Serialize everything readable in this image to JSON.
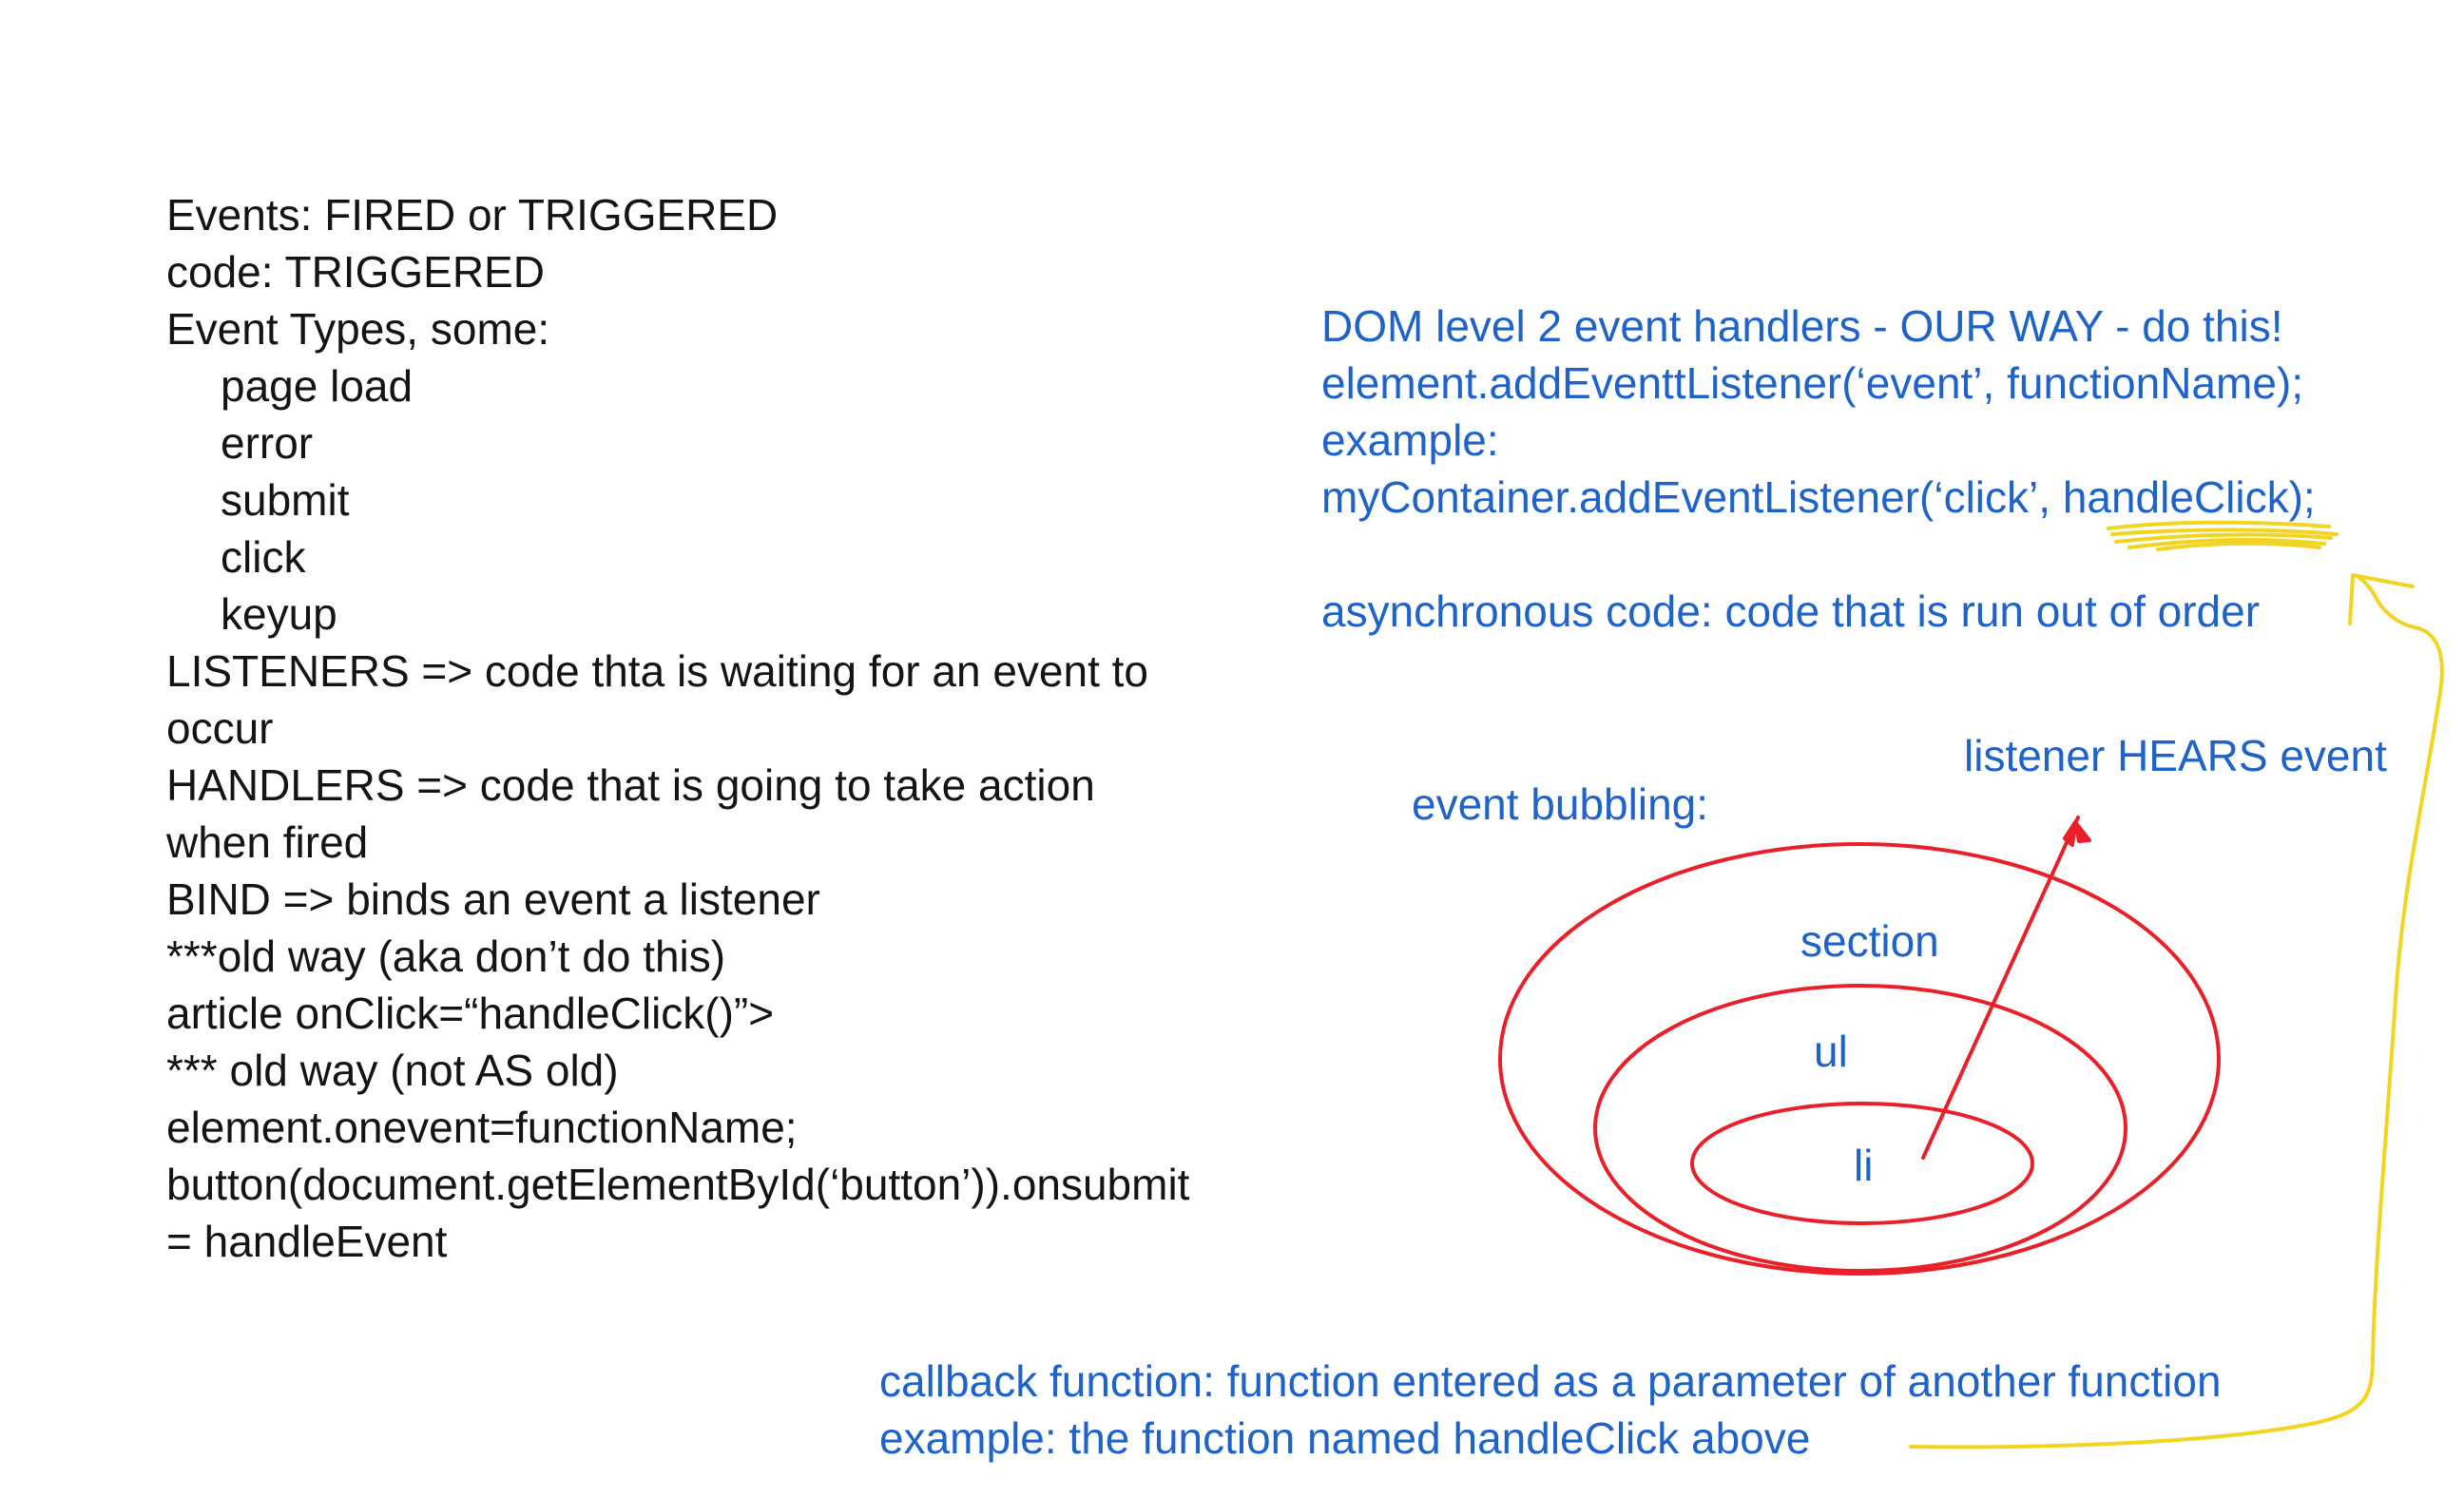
{
  "left_notes": [
    {
      "text": "Events:  FIRED or TRIGGERED",
      "indent": false
    },
    {
      "text": "code:  TRIGGERED",
      "indent": false
    },
    {
      "text": "Event Types, some:",
      "indent": false
    },
    {
      "text": "page load",
      "indent": true
    },
    {
      "text": "error",
      "indent": true
    },
    {
      "text": "submit",
      "indent": true
    },
    {
      "text": "click",
      "indent": true
    },
    {
      "text": "keyup",
      "indent": true
    },
    {
      "text": "LISTENERS => code thta is waiting for an event to",
      "indent": false
    },
    {
      "text": "occur",
      "indent": false
    },
    {
      "text": "HANDLERS => code that is going to take action",
      "indent": false
    },
    {
      "text": "when fired",
      "indent": false
    },
    {
      "text": "BIND => binds an event a listener",
      "indent": false
    },
    {
      "text": "***old way (aka don’t do this)",
      "indent": false
    },
    {
      "text": "article onClick=“handleClick()”>",
      "indent": false
    },
    {
      "text": "*** old way (not AS old)",
      "indent": false
    },
    {
      "text": "element.onevent=functionName;",
      "indent": false
    },
    {
      "text": "button(document.getElementById(‘button’)).onsubmit",
      "indent": false
    },
    {
      "text": "= handleEvent",
      "indent": false
    }
  ],
  "right_notes": {
    "line1": "DOM level 2 event handlers - OUR WAY - do this!",
    "line2": "element.addEventtListener(‘event’, functionName);",
    "line3": "example:",
    "line4_prefix": "myContainer.addEventListener(‘click’, ",
    "line4_handle": "handleClick",
    "line4_suffix": ");",
    "line5": "asynchronous code: code that is run out of order"
  },
  "bubbling": {
    "label": "event bubbling:",
    "listener_label": "listener HEARS event",
    "outer": "section",
    "middle": "ul",
    "inner": "li"
  },
  "callback": {
    "line1": "callback function: function entered as a parameter of another function",
    "line2": "example:  the function named handleClick above"
  },
  "colors": {
    "black_text": "#141414",
    "blue_text": "#1f63c9",
    "red_ink": "#e8202a",
    "yellow_ink": "#f2d422"
  }
}
